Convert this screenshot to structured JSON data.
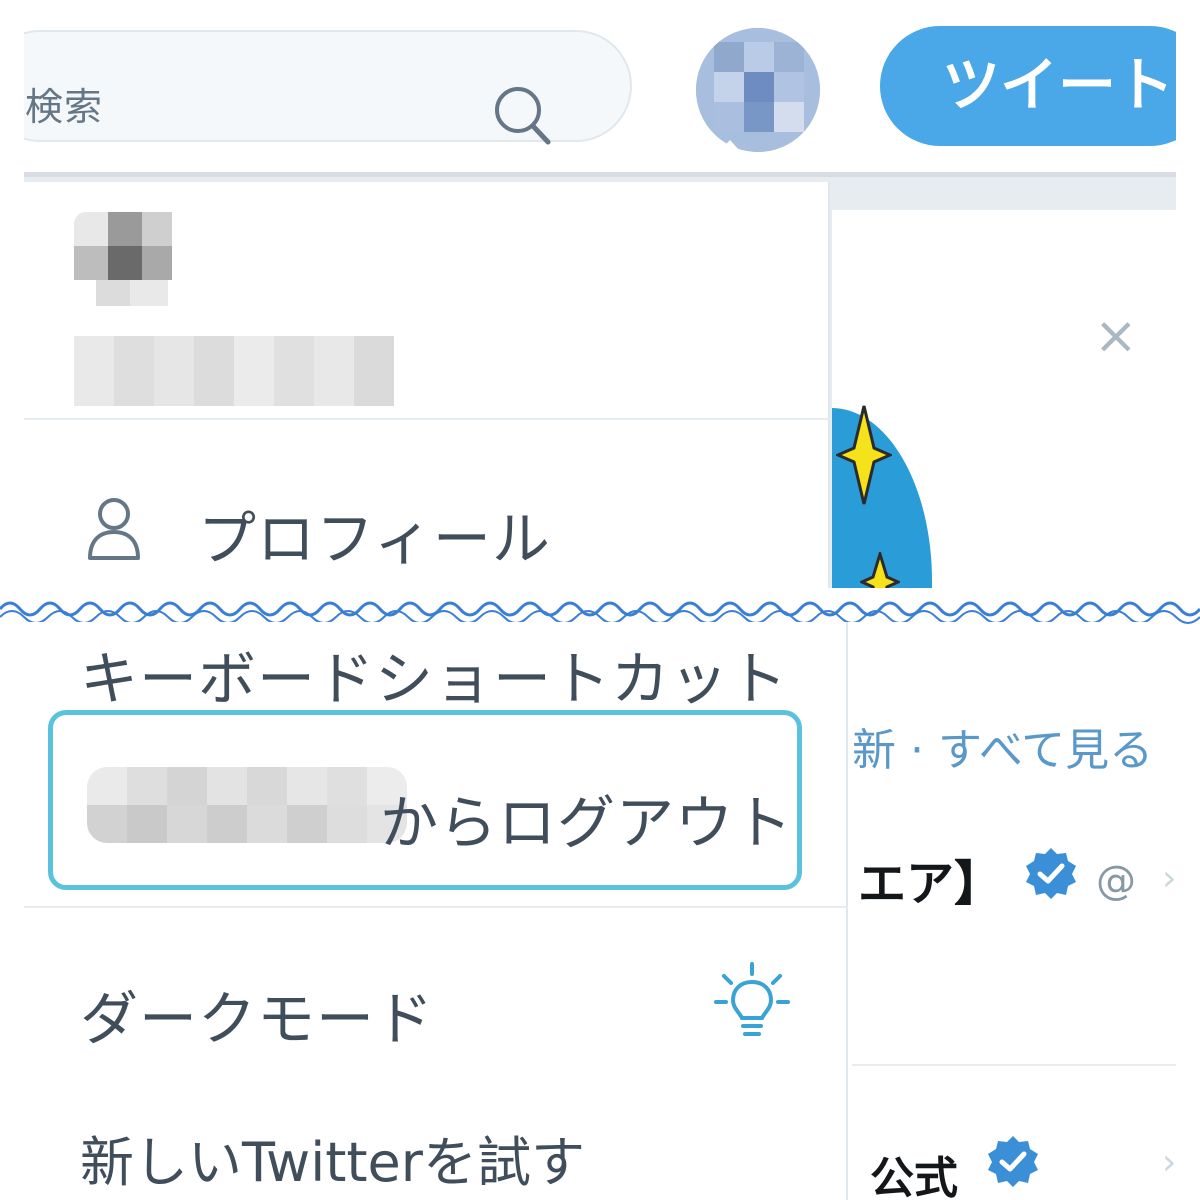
{
  "search": {
    "visible_text": "ド検索"
  },
  "header": {
    "tweet_button_label": "ツイート"
  },
  "menu": {
    "profile_label": "プロフィール",
    "shortcuts_label": "キーボードショートカット",
    "logout_label": "からログアウト",
    "dark_mode_label": "ダークモード",
    "new_twitter_label": "新しいTwitterを試す"
  },
  "side": {
    "close_glyph": "×",
    "see_all_text": "新 · すべて見る",
    "account_a_name": "エア】",
    "account_a_handle": "@",
    "account_b_name": "公式",
    "chevron": "›"
  },
  "icons": {
    "search": "search-icon",
    "profile": "person-icon",
    "dark_mode": "lightbulb-icon",
    "verified": "verified-badge-icon",
    "close": "close-icon"
  },
  "colors": {
    "accent": "#4aa7e8",
    "focus_outline": "#5bc2de",
    "verified": "#3b8fd6",
    "link": "#5a98c9",
    "wave": "#3b7fd4"
  }
}
